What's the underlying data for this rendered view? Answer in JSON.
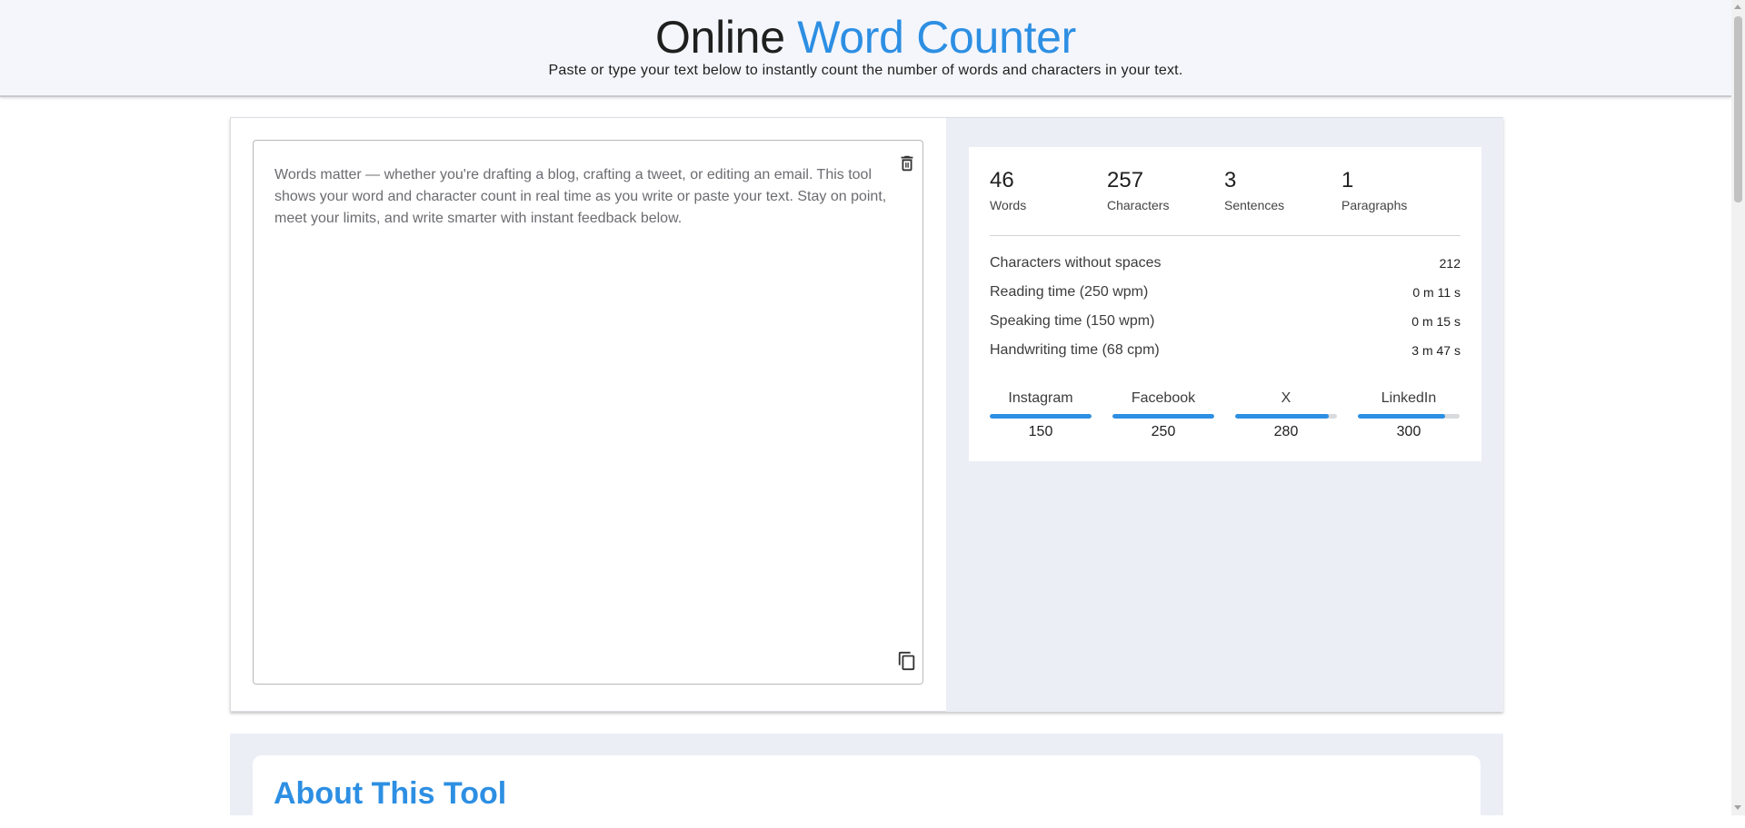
{
  "header": {
    "title_part1": "Online",
    "title_part2": "Word Counter",
    "subtitle": "Paste or type your text below to instantly count the number of words and characters in your text."
  },
  "editor": {
    "text": "Words matter — whether you're drafting a blog, crafting a tweet, or editing an email. This tool shows your word and character count in real time as you write or paste your text. Stay on point, meet your limits, and write smarter with instant feedback below."
  },
  "counts": [
    {
      "value": "46",
      "label": "Words"
    },
    {
      "value": "257",
      "label": "Characters"
    },
    {
      "value": "3",
      "label": "Sentences"
    },
    {
      "value": "1",
      "label": "Paragraphs"
    }
  ],
  "details": [
    {
      "label": "Characters without spaces",
      "value": "212"
    },
    {
      "label": "Reading time (250 wpm)",
      "value": "0 m 11 s"
    },
    {
      "label": "Speaking time (150 wpm)",
      "value": "0 m 15 s"
    },
    {
      "label": "Handwriting time (68 cpm)",
      "value": "3 m 47 s"
    }
  ],
  "social_limits": [
    {
      "name": "Instagram",
      "limit": "150",
      "fill_percent": 100
    },
    {
      "name": "Facebook",
      "limit": "250",
      "fill_percent": 100
    },
    {
      "name": "X",
      "limit": "280",
      "fill_percent": 92
    },
    {
      "name": "LinkedIn",
      "limit": "300",
      "fill_percent": 86
    }
  ],
  "about": {
    "title": "About This Tool"
  },
  "colors": {
    "accent": "#2d8fe3",
    "panel_bg": "#eceef6",
    "header_bg": "#f5f6fb"
  },
  "icons": {
    "clear": "trash-icon",
    "copy": "copy-icon"
  }
}
